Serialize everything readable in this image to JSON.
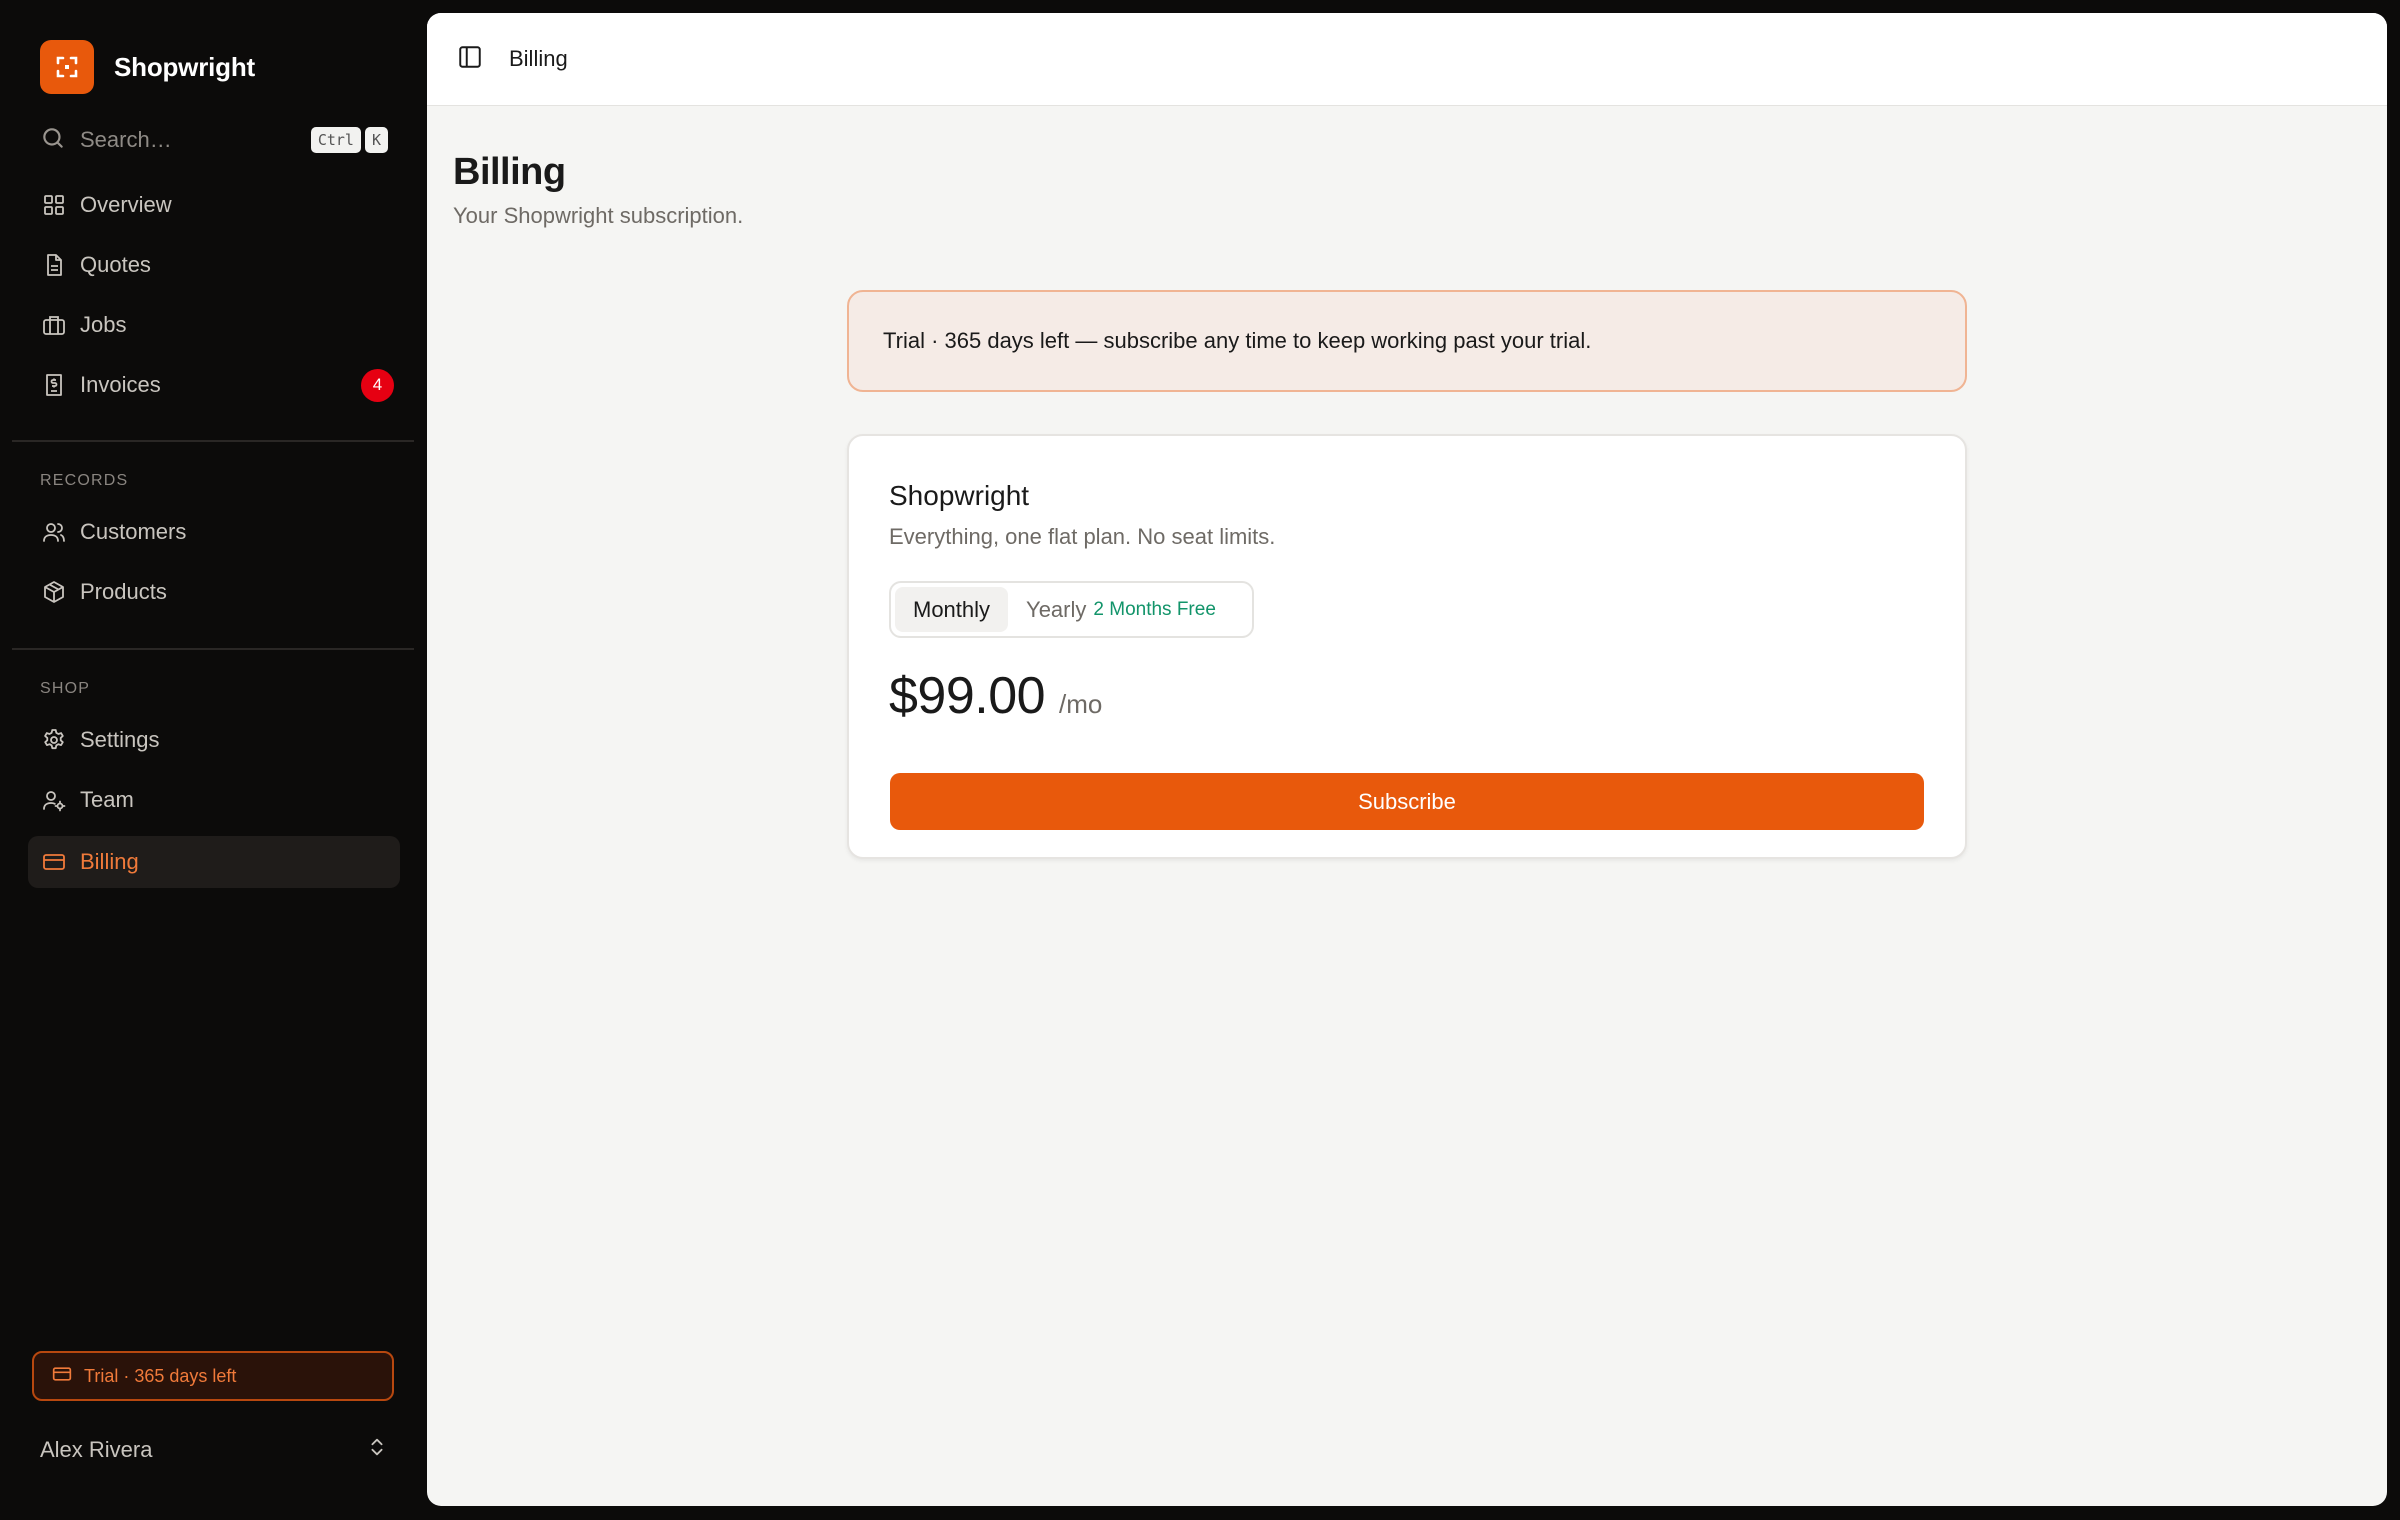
{
  "app": {
    "name": "Shopwright",
    "brand_color": "#e8590c"
  },
  "search": {
    "placeholder": "Search…",
    "shortcut_keys": [
      "Ctrl",
      "K"
    ]
  },
  "nav": {
    "main": [
      {
        "label": "Overview",
        "icon": "grid-icon"
      },
      {
        "label": "Quotes",
        "icon": "document-icon"
      },
      {
        "label": "Jobs",
        "icon": "briefcase-icon"
      },
      {
        "label": "Invoices",
        "icon": "receipt-icon",
        "badge": "4"
      }
    ],
    "records_label": "RECORDS",
    "records": [
      {
        "label": "Customers",
        "icon": "users-icon"
      },
      {
        "label": "Products",
        "icon": "package-icon"
      }
    ],
    "shop_label": "SHOP",
    "shop": [
      {
        "label": "Settings",
        "icon": "gear-icon"
      },
      {
        "label": "Team",
        "icon": "user-settings-icon"
      },
      {
        "label": "Billing",
        "icon": "credit-card-icon",
        "active": true
      }
    ]
  },
  "sidebar_footer": {
    "trial_label": "Trial · 365 days left",
    "user_name": "Alex Rivera"
  },
  "topbar": {
    "title": "Billing"
  },
  "page": {
    "title": "Billing",
    "subtitle": "Your Shopwright subscription."
  },
  "banner": {
    "text": "Trial · 365 days left — subscribe any time to keep working past your trial."
  },
  "plan": {
    "name": "Shopwright",
    "description": "Everything, one flat plan. No seat limits.",
    "toggle": {
      "monthly_label": "Monthly",
      "yearly_label": "Yearly",
      "yearly_promo": "2 Months Free",
      "selected": "monthly"
    },
    "price": "$99.00",
    "period": "/mo",
    "subscribe_label": "Subscribe"
  }
}
